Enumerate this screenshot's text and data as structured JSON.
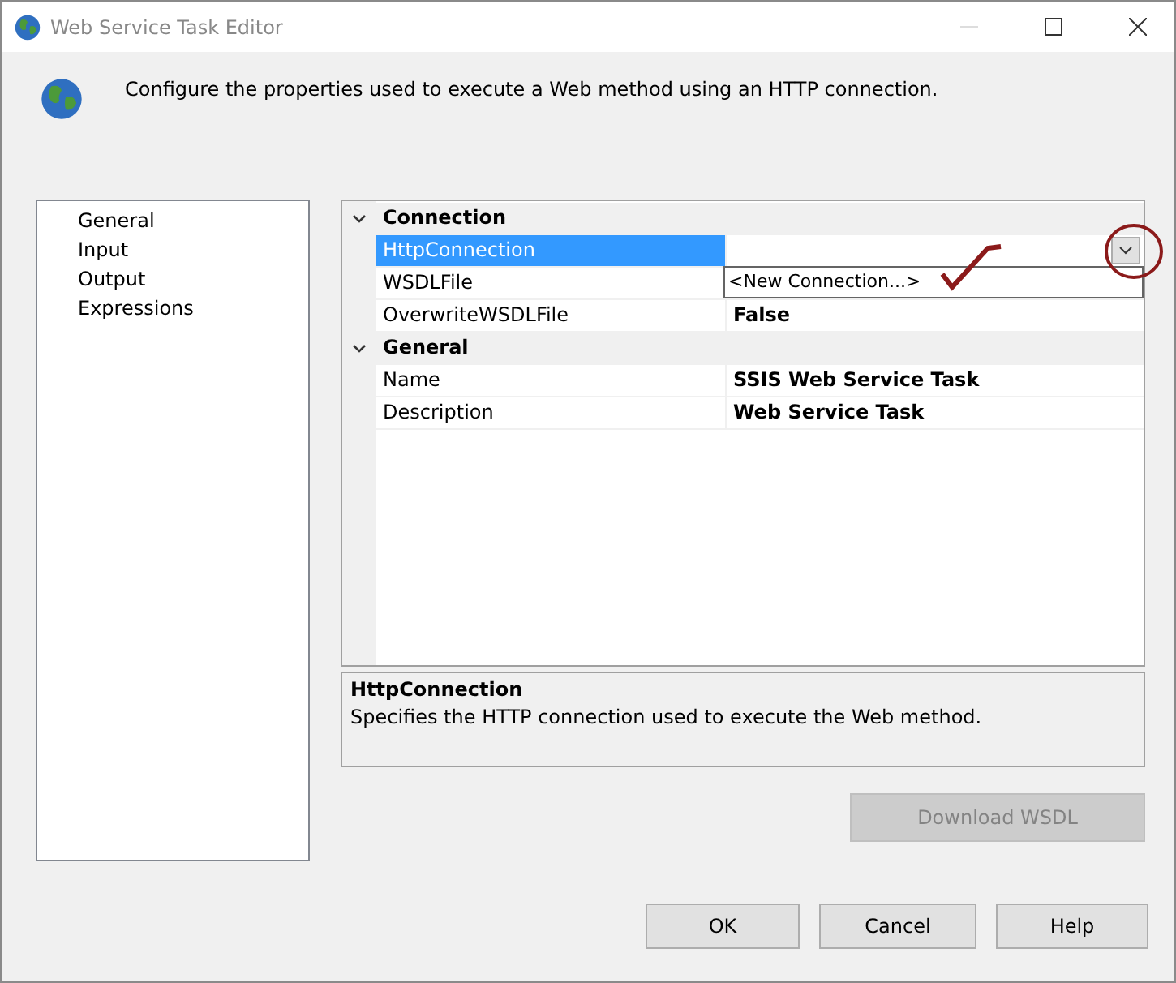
{
  "window": {
    "title": "Web Service Task Editor"
  },
  "header": {
    "text": "Configure the properties used to execute a Web method using an HTTP connection."
  },
  "sidebar": {
    "items": [
      {
        "label": "General",
        "selected": false
      },
      {
        "label": "Input",
        "selected": false
      },
      {
        "label": "Output",
        "selected": false
      },
      {
        "label": "Expressions",
        "selected": false
      }
    ]
  },
  "property_grid": {
    "categories": [
      {
        "name": "Connection",
        "expanded": true,
        "properties": [
          {
            "name": "HttpConnection",
            "selected": true,
            "dropdown_open": true,
            "dropdown_items": [
              "<New Connection...>"
            ]
          },
          {
            "name": "WSDLFile",
            "selected": false
          },
          {
            "name": "OverwriteWSDLFile",
            "value": "False",
            "selected": false
          }
        ]
      },
      {
        "name": "General",
        "expanded": true,
        "properties": [
          {
            "name": "Name",
            "value": "SSIS Web Service Task",
            "selected": false
          },
          {
            "name": "Description",
            "value": "Web Service Task",
            "selected": false
          }
        ]
      }
    ]
  },
  "description": {
    "title": "HttpConnection",
    "text": "Specifies the HTTP connection used to execute the Web method."
  },
  "download_button": {
    "label": "Download WSDL",
    "disabled": true
  },
  "buttons": [
    "OK",
    "Cancel",
    "Help"
  ],
  "annotations": [
    {
      "kind": "circle",
      "color": "#8b1a1a"
    },
    {
      "kind": "check",
      "color": "#8b1a1a"
    }
  ]
}
